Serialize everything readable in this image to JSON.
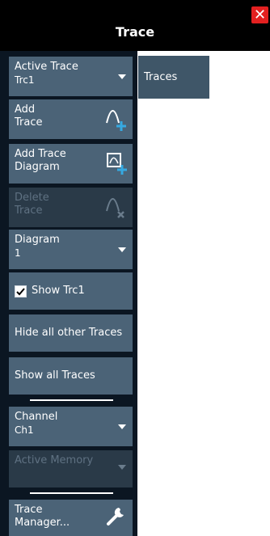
{
  "dialog": {
    "title": "Trace",
    "close_icon": "close-icon",
    "accent": "#e32020"
  },
  "tab": {
    "label": "Traces"
  },
  "buttons": {
    "active_trace": {
      "line1": "Active Trace",
      "line2": "Trc1"
    },
    "add_trace": {
      "line1": "Add",
      "line2": "Trace"
    },
    "add_trace_diagram": {
      "line1": "Add Trace",
      "line2": "Diagram"
    },
    "delete_trace": {
      "line1": "Delete",
      "line2": "Trace"
    },
    "diagram": {
      "line1": "Diagram",
      "line2": "1"
    },
    "show_trc1": {
      "label": "Show Trc1",
      "checked": true
    },
    "hide_all_other": {
      "label": "Hide all other Traces"
    },
    "show_all": {
      "label": "Show all Traces"
    },
    "channel": {
      "line1": "Channel",
      "line2": "Ch1"
    },
    "active_memory": {
      "line1": "Active Memory"
    },
    "trace_manager": {
      "line1": "Trace",
      "line2": "Manager..."
    }
  },
  "colors": {
    "button_bg": "#4b6377",
    "panel_bg": "#0b1622",
    "plus": "#36a9e1"
  }
}
